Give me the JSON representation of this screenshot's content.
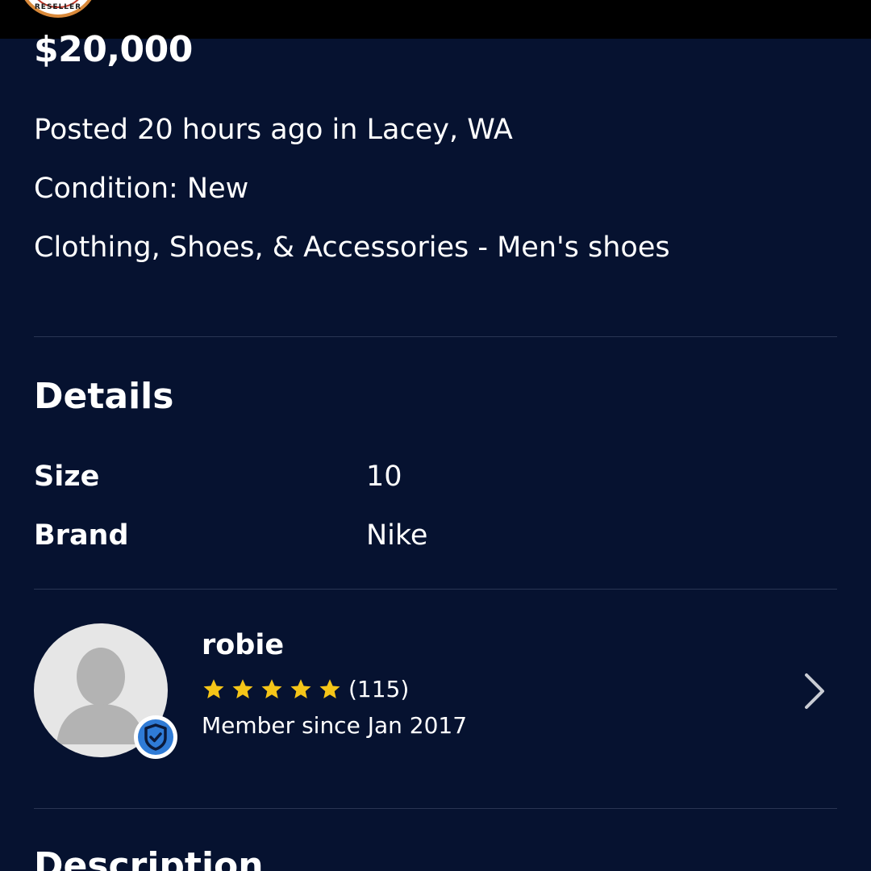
{
  "badge": {
    "text": "RESELLER"
  },
  "listing": {
    "price": "$20,000",
    "posted": "Posted 20 hours ago in Lacey, WA",
    "condition": "Condition: New",
    "category": "Clothing, Shoes, & Accessories - Men's shoes"
  },
  "details": {
    "title": "Details",
    "rows": [
      {
        "label": "Size",
        "value": "10"
      },
      {
        "label": "Brand",
        "value": "Nike"
      }
    ]
  },
  "seller": {
    "name": "robie",
    "rating_stars": 5,
    "review_count": "(115)",
    "member_since": "Member since Jan 2017",
    "verified": true
  },
  "description": {
    "title": "Description"
  },
  "colors": {
    "background": "#061230",
    "topbar": "#000000",
    "divider": "#2a3553",
    "star": "#f5c518",
    "verified": "#2f7bd6",
    "avatar_bg": "#e6e6e6",
    "avatar_figure": "#b3b3b3",
    "chevron": "#c9ccd4"
  },
  "icons": {
    "avatar": "person-silhouette-icon",
    "verified": "verified-check-icon",
    "star": "star-icon",
    "chevron": "chevron-right-icon"
  }
}
